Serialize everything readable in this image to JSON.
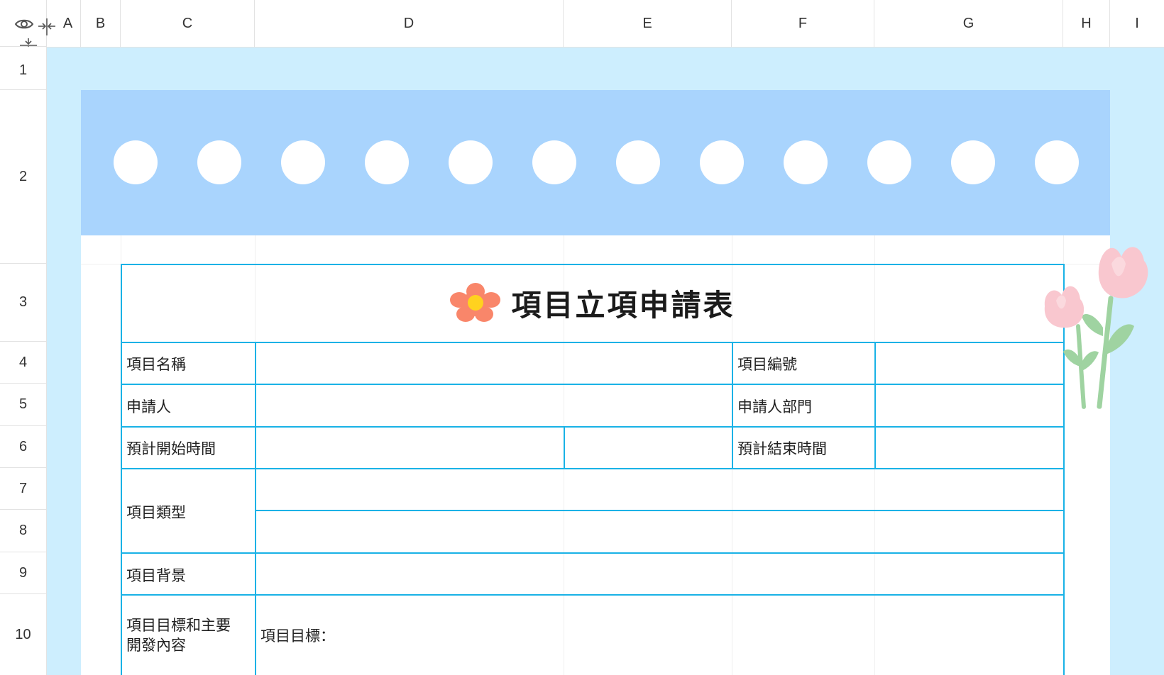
{
  "columns": [
    "A",
    "B",
    "C",
    "D",
    "E",
    "F",
    "G",
    "H",
    "I"
  ],
  "rows": [
    "1",
    "2",
    "3",
    "4",
    "5",
    "6",
    "7",
    "8",
    "9",
    "10"
  ],
  "icons": {
    "toggle_visibility": "eye-icon",
    "freeze_columns": "freeze-columns-icon",
    "freeze_rows": "freeze-rows-icon",
    "title_flower": "flower-icon",
    "decoration": "tulip-decoration"
  },
  "colors": {
    "outer_background": "#cdeefe",
    "banner": "#a9d4fd",
    "border": "#19b2e6",
    "flower": "#f9866a"
  },
  "form": {
    "title": "項目立項申請表",
    "project_name_label": "項目名稱",
    "project_number_label": "項目編號",
    "applicant_label": "申請人",
    "applicant_department_label": "申請人部門",
    "planned_start_label": "預計開始時間",
    "planned_end_label": "預計結束時間",
    "project_type_label": "項目類型",
    "project_background_label": "項目背景",
    "goals_label_line1": "項目目標和主要",
    "goals_label_line2": "開發內容",
    "goals_value": "項目目標："
  }
}
